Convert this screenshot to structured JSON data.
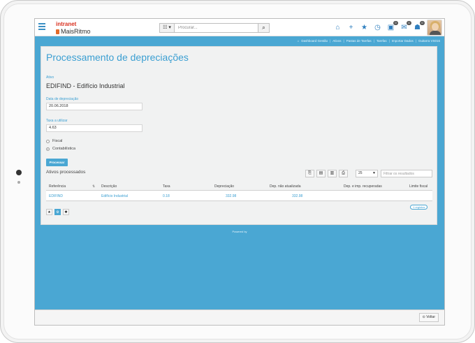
{
  "header": {
    "logo_top": "intranet",
    "logo_bottom": "MaisRitmo",
    "search_type": "☷ ▾",
    "search_placeholder": "Procurar...",
    "badges": [
      "0",
      "0",
      "0"
    ]
  },
  "breadcrumb": [
    "Dashboard Gestão",
    "Ativos",
    "Pastas de Tarefas",
    "Tarefas",
    "Importar Dados",
    "Guitarra VS016"
  ],
  "page": {
    "title": "Processamento de depreciações",
    "asset_label": "Ativo",
    "asset_name": "EDIFIND - Edifício Industrial",
    "date_label": "Data de depreciação",
    "date_value": "20.06.2018",
    "rate_label": "Taxa a utilizar",
    "rate_value": "4.63",
    "radio_fiscal": "Fiscal",
    "radio_contab": "Contabilística",
    "process_button": "Processar"
  },
  "results": {
    "title": "Ativos processados",
    "page_size": "25",
    "filter_placeholder": "Filtrar os resultados",
    "columns": [
      "Referência",
      "Descrição",
      "Taxa",
      "Depreciação",
      "Dep. não atualizada",
      "Dep. e imp. recuperadas",
      "Limite fiscal"
    ],
    "rows": [
      {
        "ref": "EDIFIND",
        "desc": "Edifício Industrial",
        "rate": "0.18",
        "dep": "332.98",
        "dep_na": "332.98",
        "dep_rec": "",
        "limit": ""
      }
    ],
    "footer_badge": "1 registos"
  },
  "footer": {
    "powered": "Powered by",
    "back": "Voltar"
  }
}
